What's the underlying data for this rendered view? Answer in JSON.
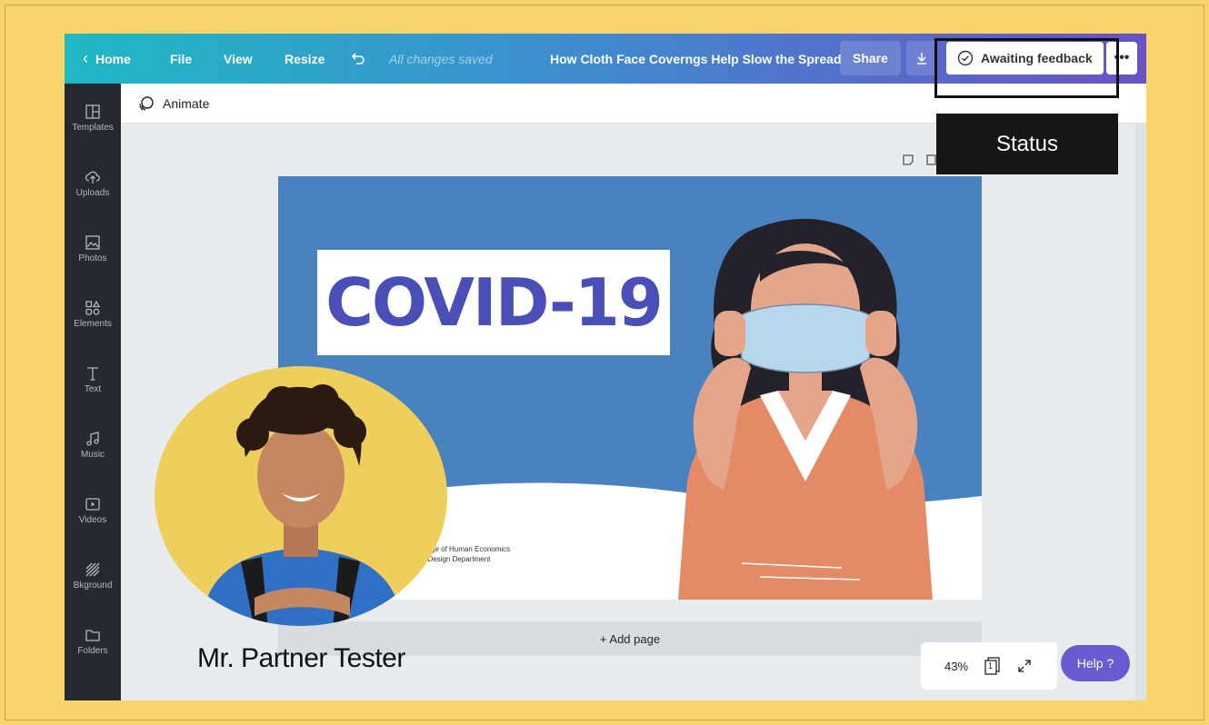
{
  "topbar": {
    "home_label": "Home",
    "file_label": "File",
    "view_label": "View",
    "resize_label": "Resize",
    "saved_status": "All changes saved",
    "doc_title": "How Cloth Face Coverngs Help Slow the Spread",
    "share_label": "Share",
    "status_button_label": "Awaiting feedback"
  },
  "sidebar": {
    "items": [
      {
        "label": "Templates",
        "icon": "templates-icon"
      },
      {
        "label": "Uploads",
        "icon": "uploads-icon"
      },
      {
        "label": "Photos",
        "icon": "photos-icon"
      },
      {
        "label": "Elements",
        "icon": "elements-icon"
      },
      {
        "label": "Text",
        "icon": "text-icon"
      },
      {
        "label": "Music",
        "icon": "music-icon"
      },
      {
        "label": "Videos",
        "icon": "videos-icon"
      },
      {
        "label": "Bkground",
        "icon": "background-icon"
      },
      {
        "label": "Folders",
        "icon": "folders-icon"
      }
    ]
  },
  "toolbar": {
    "animate_label": "Animate"
  },
  "slide": {
    "heading": "COVID-19",
    "credit_line1": "llege of Human Economics",
    "credit_line2": "/ Design Department",
    "colors": {
      "background": "#4a82c0",
      "heading": "#4a4fb8"
    }
  },
  "canvas": {
    "add_page_label": "+ Add page",
    "zoom": "43%",
    "page_number": "1",
    "help_label": "Help ?"
  },
  "annotation": {
    "status_label": "Status",
    "tester_name": "Mr. Partner Tester"
  }
}
